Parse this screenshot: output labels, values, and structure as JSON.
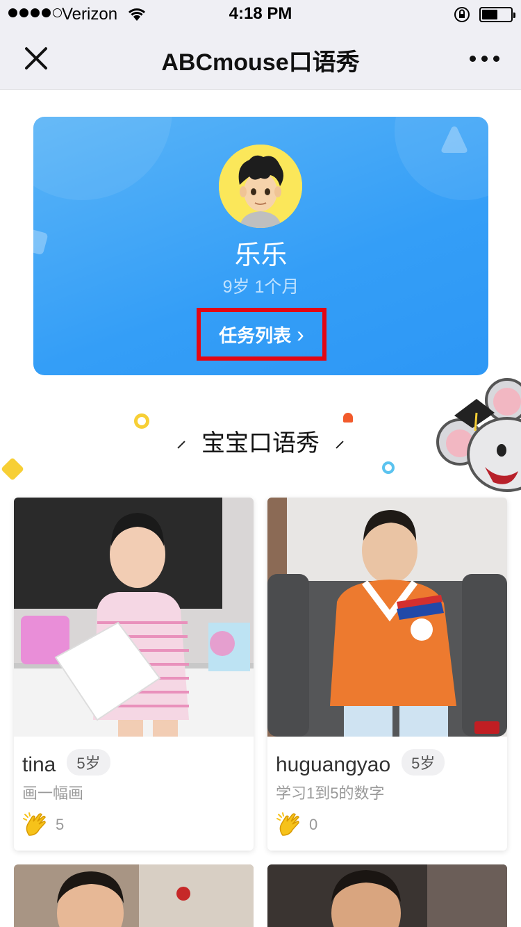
{
  "status_bar": {
    "carrier": "Verizon",
    "time": "4:18 PM"
  },
  "nav": {
    "title": "ABCmouse口语秀"
  },
  "profile": {
    "name": "乐乐",
    "age": "9岁 1个月",
    "task_button_label": "任务列表",
    "task_button_chevron": "›"
  },
  "section": {
    "title": "宝宝口语秀"
  },
  "shows": [
    {
      "name": "tina",
      "age": "5岁",
      "desc": "画一幅画",
      "claps": "5"
    },
    {
      "name": "huguangyao",
      "age": "5岁",
      "desc": "学习1到5的数字",
      "claps": "0"
    }
  ],
  "colors": {
    "accent_blue": "#349ef7",
    "highlight_red": "#e30613",
    "avatar_yellow": "#fbe75a"
  },
  "icons": [
    "close-icon",
    "more-icon",
    "chevron-right-icon",
    "clap-icon",
    "wifi-icon",
    "lock-icon",
    "battery-icon"
  ]
}
